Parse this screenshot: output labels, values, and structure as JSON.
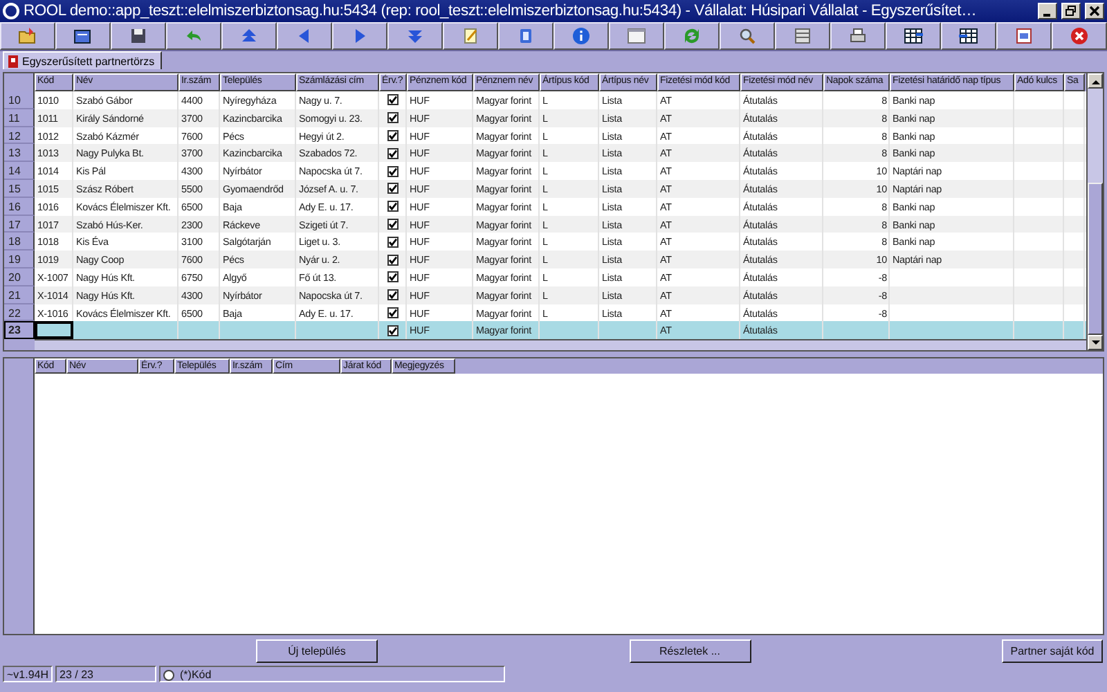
{
  "window": {
    "title": "ROOL demo::app_teszt::elelmiszerbiztonsag.hu:5434 (rep: rool_teszt::elelmiszerbiztonsag.hu:5434) - Vállalat: Húsipari Vállalat - Egyszerűsítet…"
  },
  "tabs": [
    {
      "label": "Egyszerűsített partnertörzs",
      "selected": true
    }
  ],
  "grid": {
    "columns": [
      "Kód",
      "Név",
      "Ir.szám",
      "Település",
      "Számlázási cím",
      "Érv.?",
      "Pénznem kód",
      "Pénznem név",
      "Ártípus kód",
      "Ártípus név",
      "Fizetési mód kód",
      "Fizetési mód név",
      "Napok száma",
      "Fizetési határidő nap típus",
      "Adó kulcs",
      "Sa"
    ],
    "rows": [
      {
        "num": "10",
        "selected": false,
        "valid": true,
        "cells": [
          "1010",
          "Szabó Gábor",
          "4400",
          "Nyíregyháza",
          "Nagy u. 7.",
          null,
          "HUF",
          "Magyar forint",
          "L",
          "Lista",
          "AT",
          "Átutalás",
          "8",
          "Banki nap"
        ]
      },
      {
        "num": "11",
        "selected": false,
        "valid": true,
        "cells": [
          "1011",
          "Király Sándorné",
          "3700",
          "Kazincbarcika",
          "Somogyi u. 23.",
          null,
          "HUF",
          "Magyar forint",
          "L",
          "Lista",
          "AT",
          "Átutalás",
          "8",
          "Banki nap"
        ]
      },
      {
        "num": "12",
        "selected": false,
        "valid": true,
        "cells": [
          "1012",
          "Szabó Kázmér",
          "7600",
          "Pécs",
          "Hegyi út 2.",
          null,
          "HUF",
          "Magyar forint",
          "L",
          "Lista",
          "AT",
          "Átutalás",
          "8",
          "Banki nap"
        ]
      },
      {
        "num": "13",
        "selected": false,
        "valid": true,
        "cells": [
          "1013",
          "Nagy Pulyka Bt.",
          "3700",
          "Kazincbarcika",
          "Szabados 72.",
          null,
          "HUF",
          "Magyar forint",
          "L",
          "Lista",
          "AT",
          "Átutalás",
          "8",
          "Banki nap"
        ]
      },
      {
        "num": "14",
        "selected": false,
        "valid": true,
        "cells": [
          "1014",
          "Kis Pál",
          "4300",
          "Nyírbátor",
          "Napocska út 7.",
          null,
          "HUF",
          "Magyar forint",
          "L",
          "Lista",
          "AT",
          "Átutalás",
          "10",
          "Naptári nap"
        ]
      },
      {
        "num": "15",
        "selected": false,
        "valid": true,
        "cells": [
          "1015",
          "Szász Róbert",
          "5500",
          "Gyomaendrőd",
          "József A. u. 7.",
          null,
          "HUF",
          "Magyar forint",
          "L",
          "Lista",
          "AT",
          "Átutalás",
          "10",
          "Naptári nap"
        ]
      },
      {
        "num": "16",
        "selected": false,
        "valid": true,
        "cells": [
          "1016",
          "Kovács Élelmiszer Kft.",
          "6500",
          "Baja",
          "Ady E. u. 17.",
          null,
          "HUF",
          "Magyar forint",
          "L",
          "Lista",
          "AT",
          "Átutalás",
          "8",
          "Banki nap"
        ]
      },
      {
        "num": "17",
        "selected": false,
        "valid": true,
        "cells": [
          "1017",
          "Szabó Hús-Ker.",
          "2300",
          "Ráckeve",
          "Szigeti út 7.",
          null,
          "HUF",
          "Magyar forint",
          "L",
          "Lista",
          "AT",
          "Átutalás",
          "8",
          "Banki nap"
        ]
      },
      {
        "num": "18",
        "selected": false,
        "valid": true,
        "cells": [
          "1018",
          "Kis Éva",
          "3100",
          "Salgótarján",
          "Liget u. 3.",
          null,
          "HUF",
          "Magyar forint",
          "L",
          "Lista",
          "AT",
          "Átutalás",
          "8",
          "Banki nap"
        ]
      },
      {
        "num": "19",
        "selected": false,
        "valid": true,
        "cells": [
          "1019",
          "Nagy Coop",
          "7600",
          "Pécs",
          "Nyár u. 2.",
          null,
          "HUF",
          "Magyar forint",
          "L",
          "Lista",
          "AT",
          "Átutalás",
          "10",
          "Naptári nap"
        ]
      },
      {
        "num": "20",
        "selected": false,
        "valid": true,
        "cells": [
          "X-1007",
          "Nagy Hús Kft.",
          "6750",
          "Algyő",
          "Fő út 13.",
          null,
          "HUF",
          "Magyar forint",
          "L",
          "Lista",
          "AT",
          "Átutalás",
          "-8",
          null
        ]
      },
      {
        "num": "21",
        "selected": false,
        "valid": true,
        "cells": [
          "X-1014",
          "Nagy Hús Kft.",
          "4300",
          "Nyírbátor",
          "Napocska út 7.",
          null,
          "HUF",
          "Magyar forint",
          "L",
          "Lista",
          "AT",
          "Átutalás",
          "-8",
          null
        ]
      },
      {
        "num": "22",
        "selected": false,
        "valid": true,
        "cells": [
          "X-1016",
          "Kovács Élelmiszer Kft.",
          "6500",
          "Baja",
          "Ady E. u. 17.",
          null,
          "HUF",
          "Magyar forint",
          "L",
          "Lista",
          "AT",
          "Átutalás",
          "-8",
          null
        ]
      },
      {
        "num": "23",
        "selected": true,
        "valid": true,
        "cells": [
          null,
          null,
          null,
          null,
          null,
          null,
          "HUF",
          "Magyar forint",
          null,
          null,
          "AT",
          "Átutalás",
          null,
          null
        ]
      }
    ]
  },
  "detail_grid": {
    "columns": [
      "Kód",
      "Név",
      "Érv.?",
      "Település",
      "Ir.szám",
      "Cím",
      "Járat kód",
      "Megjegyzés"
    ]
  },
  "buttons": [
    "Új település",
    "Részletek ...",
    "Partner saját kód"
  ],
  "status_bar": {
    "version": "~v1.94H",
    "count": "23 / 23",
    "sort_option": {
      "label": "(*)Kód",
      "selected": false
    }
  }
}
